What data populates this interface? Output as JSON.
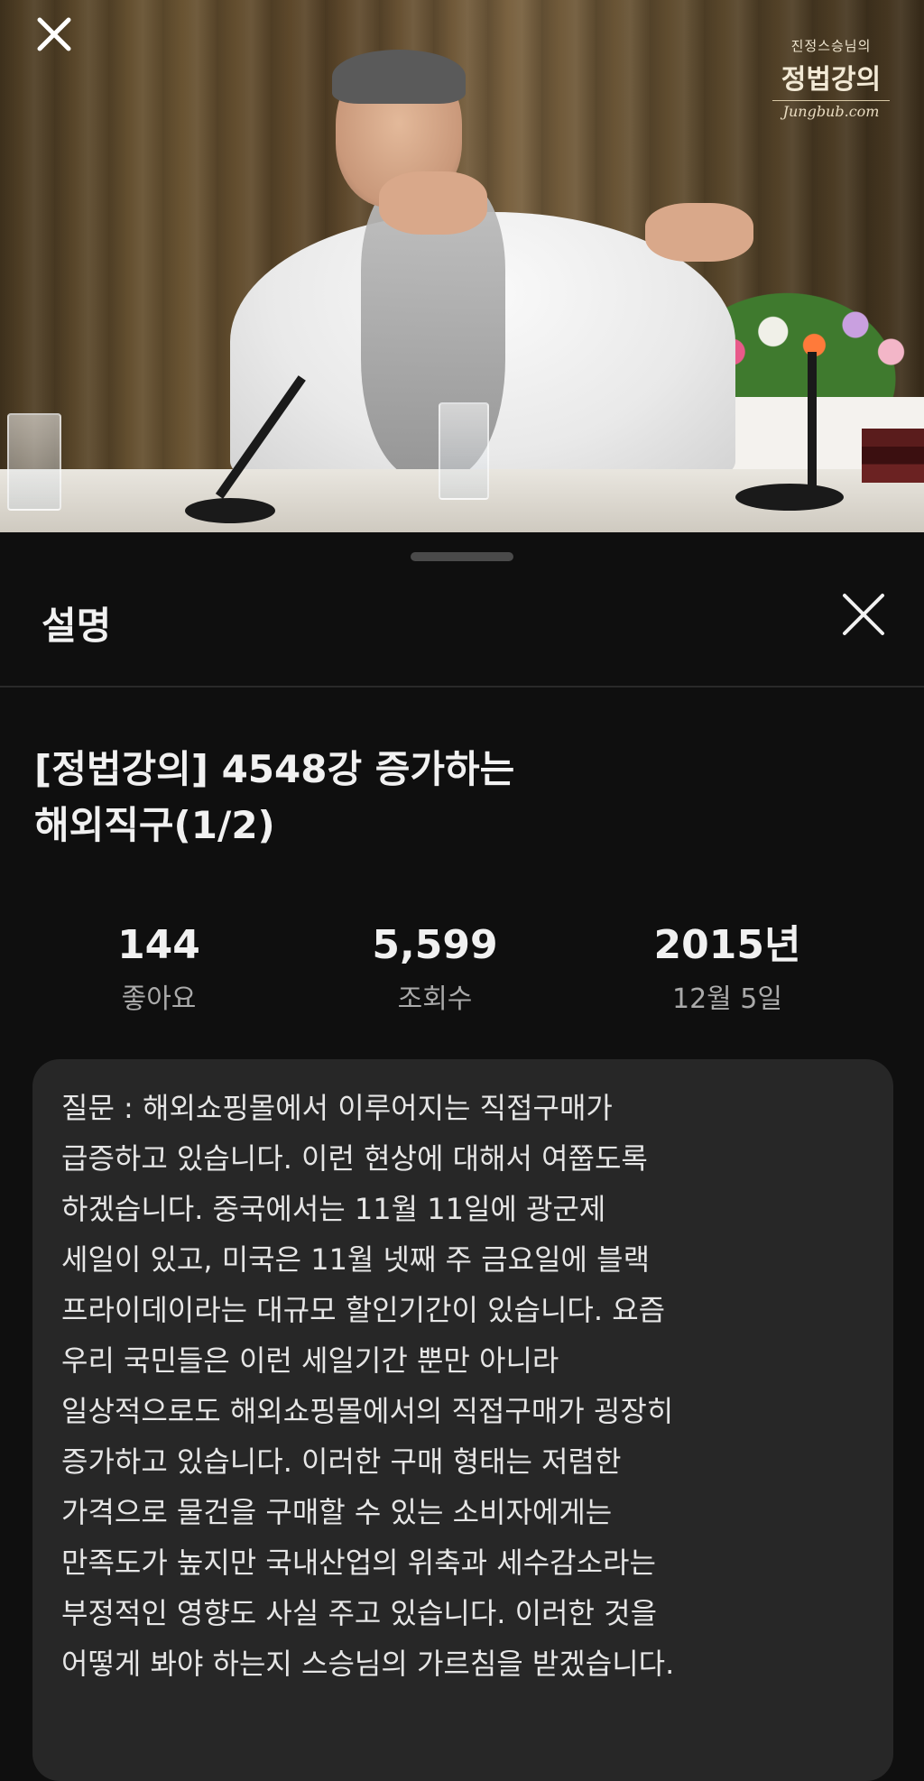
{
  "video": {
    "close_icon": "close-icon",
    "logo": {
      "line1": "진정스승님의",
      "line2": "정법강의",
      "line3": "Jungbub.com"
    }
  },
  "sheet": {
    "title": "설명",
    "close_icon": "close-icon"
  },
  "video_info": {
    "title_line1": "[정법강의] 4548강 증가하는",
    "title_line2": "해외직구(1/2)",
    "stats": [
      {
        "value": "144",
        "label": "좋아요"
      },
      {
        "value": "5,599",
        "label": "조회수"
      },
      {
        "value": "2015년",
        "label": "12월 5일"
      }
    ]
  },
  "description": {
    "lines": [
      "질문 : 해외쇼핑몰에서 이루어지는 직접구매가",
      "급증하고 있습니다. 이런 현상에 대해서 여쭙도록",
      "하겠습니다. 중국에서는 11월 11일에 광군제",
      "세일이 있고, 미국은 11월 넷째 주 금요일에 블랙",
      "프라이데이라는 대규모 할인기간이 있습니다. 요즘",
      "우리 국민들은 이런 세일기간 뿐만 아니라",
      "일상적으로도 해외쇼핑몰에서의 직접구매가 굉장히",
      "증가하고 있습니다. 이러한 구매 형태는 저렴한",
      "가격으로 물건을 구매할 수 있는 소비자에게는",
      "만족도가 높지만 국내산업의 위축과 세수감소라는",
      "부정적인 영향도 사실 주고 있습니다. 이러한 것을",
      "어떻게 봐야 하는지 스승님의 가르침을 받겠습니다."
    ]
  },
  "colors": {
    "background": "#0f0f0f",
    "description_box": "#272727",
    "secondary_text": "#aaaaaa"
  }
}
